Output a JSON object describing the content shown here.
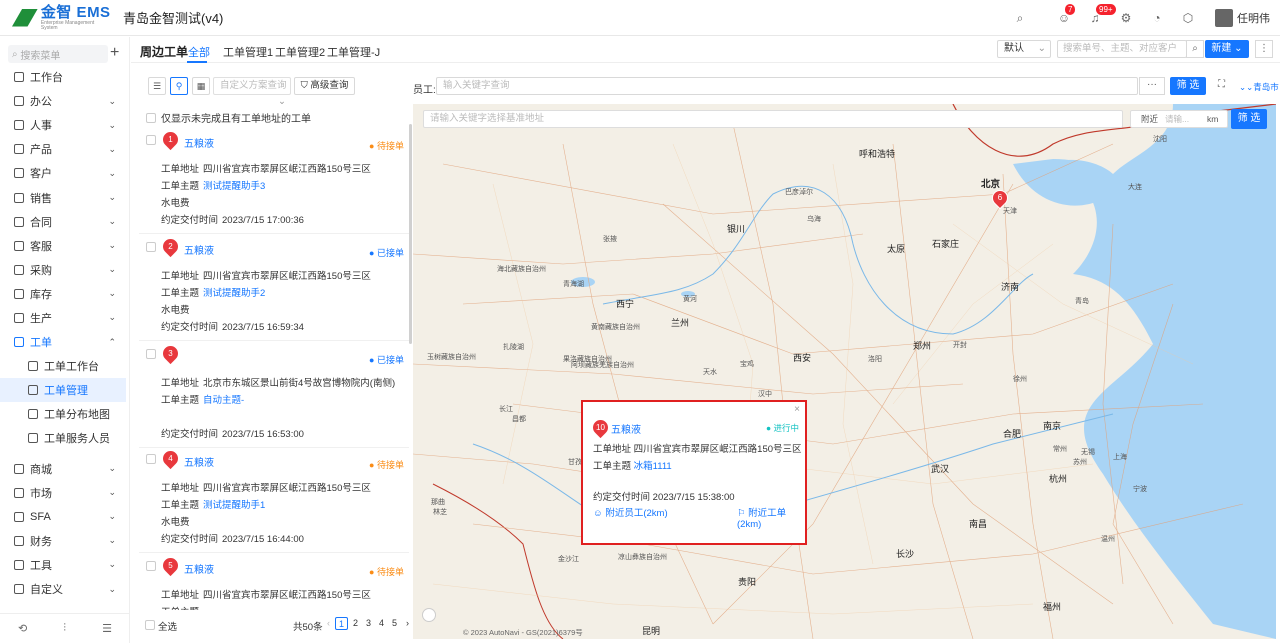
{
  "header": {
    "logo_text": "金智 EMS",
    "logo_sub": "Enterprise Management System",
    "app_title": "青岛金智测试(v4)",
    "badges": {
      "users": "7",
      "bell": "99+"
    },
    "user_name": "任明伟"
  },
  "sidebar": {
    "search_placeholder": "搜索菜单",
    "items": [
      {
        "label": "工作台"
      },
      {
        "label": "办公"
      },
      {
        "label": "人事"
      },
      {
        "label": "产品"
      },
      {
        "label": "客户"
      },
      {
        "label": "销售"
      },
      {
        "label": "合同"
      },
      {
        "label": "客服"
      },
      {
        "label": "采购"
      },
      {
        "label": "库存"
      },
      {
        "label": "生产"
      },
      {
        "label": "工单"
      },
      {
        "label": "工单工作台"
      },
      {
        "label": "工单管理"
      },
      {
        "label": "工单分布地图"
      },
      {
        "label": "工单服务人员"
      },
      {
        "label": "商城"
      },
      {
        "label": "市场"
      },
      {
        "label": "SFA"
      },
      {
        "label": "财务"
      },
      {
        "label": "工具"
      },
      {
        "label": "自定义"
      }
    ]
  },
  "tabs": {
    "page_title": "周边工单",
    "items": [
      "全部",
      "工单管理1",
      "工单管理2",
      "工单管理-J"
    ],
    "sort_value": "默认",
    "keyword_placeholder": "搜索单号、主题、对应客户",
    "new_label": "新建"
  },
  "toolbar": {
    "scheme_placeholder": "自定义方案查询",
    "advanced_label": "高级查询",
    "employee_label": "员工:",
    "employee_placeholder": "输入关键字查询",
    "filter_label": "筛 选",
    "city_label": "青岛市"
  },
  "list": {
    "only_unfinished_label": "仅显示未完成且有工单地址的工单",
    "field_address": "工单地址",
    "field_subject": "工单主题",
    "field_due": "约定交付时间",
    "cards": [
      {
        "num": "1",
        "name": "五粮液",
        "status": "待接单",
        "status_type": "wait",
        "address": "四川省宜宾市翠屏区岷江西路150号三区",
        "subject": "测试提醒助手3",
        "extra": "水电费",
        "due": "2023/7/15 17:00:36"
      },
      {
        "num": "2",
        "name": "五粮液",
        "status": "已接单",
        "status_type": "ok",
        "address": "四川省宜宾市翠屏区岷江西路150号三区",
        "subject": "测试提醒助手2",
        "extra": "水电费",
        "due": "2023/7/15 16:59:34"
      },
      {
        "num": "3",
        "name": "",
        "status": "已接单",
        "status_type": "ok",
        "address": "北京市东城区景山前街4号故宫博物院内(南侧)",
        "subject": "自动主题-",
        "extra": "",
        "due": "2023/7/15 16:53:00"
      },
      {
        "num": "4",
        "name": "五粮液",
        "status": "待接单",
        "status_type": "wait",
        "address": "四川省宜宾市翠屏区岷江西路150号三区",
        "subject": "测试提醒助手1",
        "extra": "水电费",
        "due": "2023/7/15 16:44:00"
      },
      {
        "num": "5",
        "name": "五粮液",
        "status": "待接单",
        "status_type": "wait",
        "address": "四川省宜宾市翠屏区岷江西路150号三区",
        "subject": "",
        "extra": "",
        "due": ""
      }
    ],
    "select_all": "全选",
    "total": "共50条",
    "pages": [
      "1",
      "2",
      "3",
      "4",
      "5"
    ]
  },
  "map": {
    "search_placeholder": "请输入关键字选择基准地址",
    "nearby_label": "附近",
    "nearby_placeholder": "请输...",
    "unit": "km",
    "filter_label": "筛 选",
    "attribution": "© 2023 AutoNavi - GS(2021)6379号",
    "cities": [
      {
        "name": "呼和浩特",
        "big": false
      },
      {
        "name": "北京",
        "big": true
      },
      {
        "name": "天津",
        "big": false
      },
      {
        "name": "银川",
        "big": false
      },
      {
        "name": "太原",
        "big": false
      },
      {
        "name": "石家庄",
        "big": false
      },
      {
        "name": "济南",
        "big": false
      },
      {
        "name": "西宁",
        "big": false
      },
      {
        "name": "兰州",
        "big": false
      },
      {
        "name": "郑州",
        "big": false
      },
      {
        "name": "西安",
        "big": false
      },
      {
        "name": "合肥",
        "big": false
      },
      {
        "name": "南京",
        "big": false
      },
      {
        "name": "武汉",
        "big": false
      },
      {
        "name": "杭州",
        "big": false
      },
      {
        "name": "南昌",
        "big": false
      },
      {
        "name": "长沙",
        "big": false
      },
      {
        "name": "贵阳",
        "big": false
      },
      {
        "name": "福州",
        "big": false
      },
      {
        "name": "昆明",
        "big": false
      },
      {
        "name": "巴彦淖尔",
        "big": false
      },
      {
        "name": "乌海",
        "big": false
      },
      {
        "name": "张掖",
        "big": false
      },
      {
        "name": "那曲",
        "big": false
      },
      {
        "name": "林芝",
        "big": false
      },
      {
        "name": "昌都",
        "big": false
      },
      {
        "name": "宁波",
        "big": false
      },
      {
        "name": "温州",
        "big": false
      },
      {
        "name": "上海",
        "big": false
      },
      {
        "name": "苏州",
        "big": false
      },
      {
        "name": "无锡",
        "big": false
      },
      {
        "name": "常州",
        "big": false
      },
      {
        "name": "徐州",
        "big": false
      },
      {
        "name": "青岛",
        "big": false
      },
      {
        "name": "大连",
        "big": false
      },
      {
        "name": "沈阳",
        "big": false
      },
      {
        "name": "开封",
        "big": false
      },
      {
        "name": "洛阳",
        "big": false
      },
      {
        "name": "宝鸡",
        "big": false
      },
      {
        "name": "天水",
        "big": false
      },
      {
        "name": "汉中",
        "big": false
      },
      {
        "name": "重庆",
        "big": false
      },
      {
        "name": "成都",
        "big": false
      },
      {
        "name": "黄南藏族自治州",
        "big": false
      },
      {
        "name": "海北藏族自治州",
        "big": false
      },
      {
        "name": "果洛藏族自治州",
        "big": false
      },
      {
        "name": "玉树藏族自治州",
        "big": false
      },
      {
        "name": "扎陵湖",
        "big": false
      },
      {
        "name": "青海湖",
        "big": false
      },
      {
        "name": "黄河",
        "big": false
      },
      {
        "name": "长江",
        "big": false
      },
      {
        "name": "金沙江",
        "big": false
      },
      {
        "name": "凉山彝族自治州",
        "big": false
      },
      {
        "name": "阿坝藏族羌族自治州",
        "big": false
      },
      {
        "name": "甘孜藏族自治州",
        "big": false
      }
    ],
    "pins": [
      "6",
      "2"
    ],
    "popup": {
      "num": "10",
      "name": "五粮液",
      "status": "进行中",
      "address_label": "工单地址",
      "address": "四川省宜宾市翠屏区岷江西路150号三区",
      "subject_label": "工单主题",
      "subject": "冰箱1111",
      "due_label": "约定交付时间",
      "due": "2023/7/15 15:38:00",
      "near_staff": "附近员工(2km)",
      "near_orders": "附近工单(2km)"
    }
  }
}
